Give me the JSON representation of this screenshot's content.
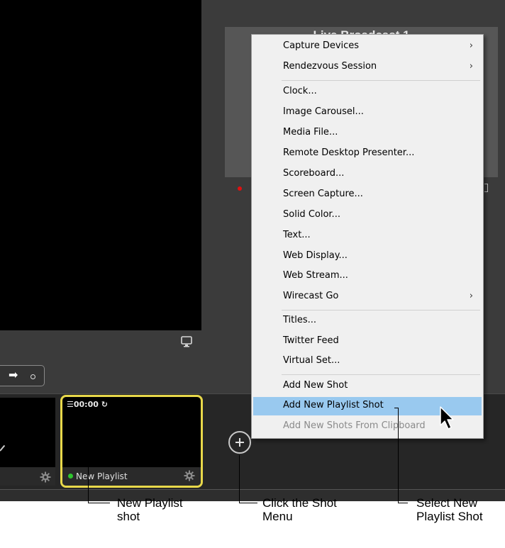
{
  "live_thumbnail": {
    "title": "Live Broadcast 1"
  },
  "shot_bar": {
    "playlist_shot": {
      "time": "00:00",
      "name": "New Playlist",
      "status_color": "#2ec52e",
      "border_color": "#e8d84a"
    }
  },
  "menu": {
    "items": [
      {
        "label": "Capture Devices",
        "submenu": "›"
      },
      {
        "label": "Rendezvous Session",
        "submenu": "›"
      },
      {
        "label": "Clock..."
      },
      {
        "label": "Image Carousel..."
      },
      {
        "label": "Media File..."
      },
      {
        "label": "Remote Desktop Presenter..."
      },
      {
        "label": "Scoreboard..."
      },
      {
        "label": "Screen Capture..."
      },
      {
        "label": "Solid Color..."
      },
      {
        "label": "Text..."
      },
      {
        "label": "Web Display..."
      },
      {
        "label": "Web Stream..."
      },
      {
        "label": "Wirecast Go",
        "submenu": "›"
      },
      {
        "label": "Titles..."
      },
      {
        "label": "Twitter Feed"
      },
      {
        "label": "Virtual Set..."
      },
      {
        "label": "Add New Shot"
      },
      {
        "label": "Add New Playlist Shot",
        "state": "highlighted"
      },
      {
        "label": "Add New Shots From Clipboard",
        "state": "disabled"
      }
    ],
    "highlight_color": "#99c9ef"
  },
  "annotations": {
    "playlist_shot": {
      "line1": "New Playlist",
      "line2": "shot"
    },
    "shot_menu": {
      "line1": "Click the Shot",
      "line2": "Menu"
    },
    "select_item": {
      "line1": "Select New",
      "line2": "Playlist Shot"
    }
  }
}
